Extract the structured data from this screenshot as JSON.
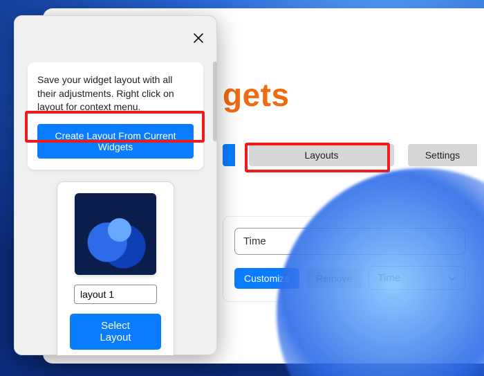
{
  "main": {
    "title_fragment": "gets",
    "tabs": {
      "layouts": "Layouts",
      "settings": "Settings"
    },
    "widget": {
      "name_value": "Time",
      "customize": "Customize",
      "remove": "Remove",
      "select_value": "Time"
    }
  },
  "popup": {
    "tooltip": "Save your widget layout with all their adjustments. Right click on layout for context menu.",
    "create_button": "Create Layout From Current Widgets",
    "layout": {
      "name_value": "layout 1",
      "select_button": "Select Layout"
    }
  }
}
